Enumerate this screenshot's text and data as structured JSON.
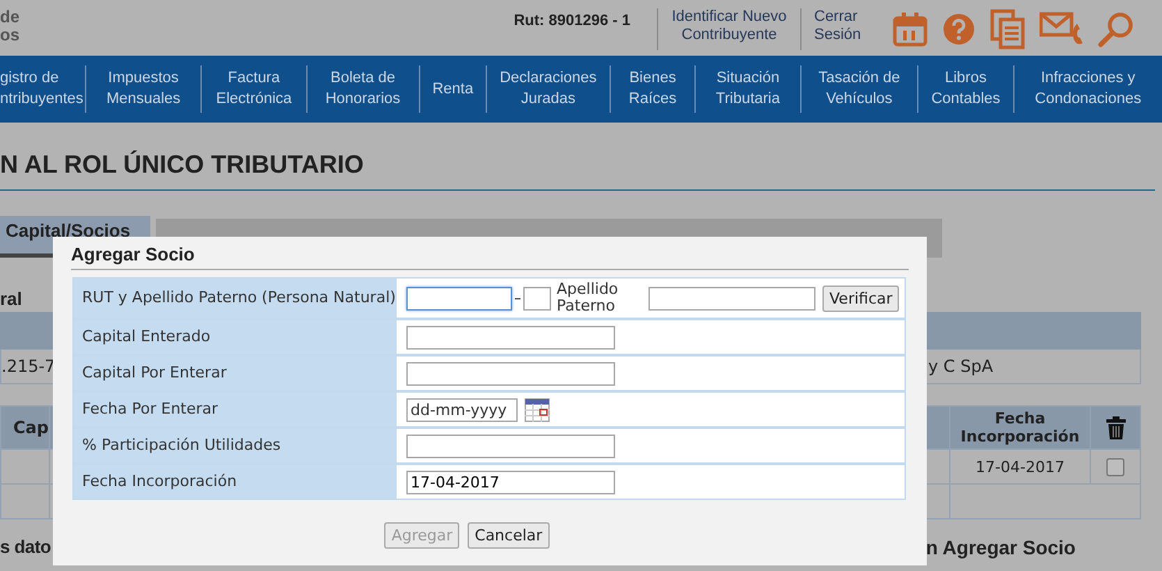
{
  "header": {
    "logo_lines": [
      "de",
      "os"
    ],
    "rut": "Rut: 8901296 - 1",
    "links": [
      "Identificar Nuevo Contribuyente",
      "Cerrar Sesión"
    ]
  },
  "nav": {
    "items": [
      "gistro de ntribuyentes",
      "Impuestos Mensuales",
      "Factura Electrónica",
      "Boleta de Honorarios",
      "Renta",
      "Declaraciones Juradas",
      "Bienes Raíces",
      "Situación Tributaria",
      "Tasación de Vehículos",
      "Libros Contables",
      "Infracciones y Condonaciones"
    ]
  },
  "page_title": "N AL ROL ÚNICO TRIBUTARIO",
  "tabs": [
    {
      "label": "Capital/Socios",
      "selected": true
    }
  ],
  "section_label": "ral",
  "company_row": {
    "column_1": ".215-7",
    "column_2": "y C SpA"
  },
  "socios_table": {
    "columns": [
      "Cap",
      "Fecha Incorporación"
    ],
    "rows": [
      {
        "fecha": "17-04-2017",
        "checked": false
      }
    ]
  },
  "footer": {
    "left": "s dato",
    "right": "n Agregar Socio"
  },
  "dialog": {
    "title": "Agregar Socio",
    "rows": [
      {
        "kind": "rut",
        "label": "RUT y Apellido Paterno (Persona Natural)",
        "focused": true,
        "sublabel": "Apellido Paterno",
        "button": "Verificar"
      },
      {
        "kind": "text",
        "label": "Capital Enterado"
      },
      {
        "kind": "text",
        "label": "Capital Por Enterar"
      },
      {
        "kind": "date",
        "label": "Fecha Por Enterar",
        "placeholder": "dd-mm-yyyy"
      },
      {
        "kind": "text",
        "label": "% Participación Utilidades"
      },
      {
        "kind": "text",
        "label": "Fecha Incorporación",
        "value": "17-04-2017"
      }
    ],
    "buttons": [
      {
        "label": "Agregar",
        "disabled": true
      },
      {
        "label": "Cancelar",
        "disabled": false
      }
    ]
  }
}
